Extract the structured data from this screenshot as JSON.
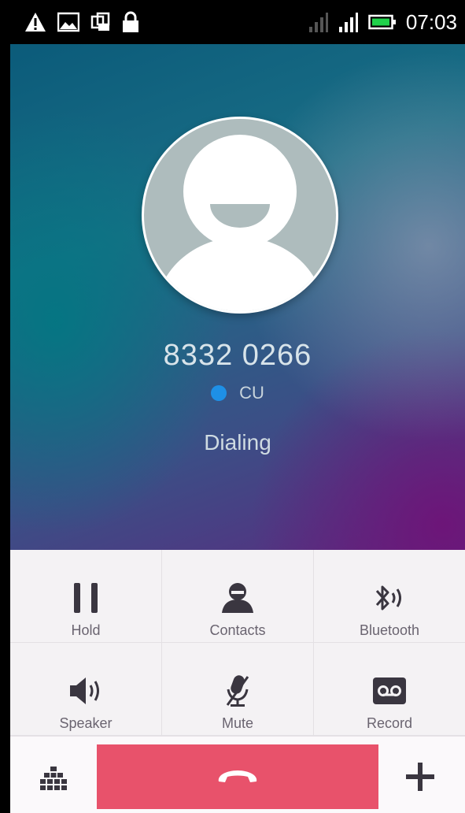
{
  "status_bar": {
    "time": "07:03",
    "left_icons": [
      "warning-icon",
      "image-icon",
      "screenshot-icon",
      "lock-icon"
    ],
    "right_icons": [
      "signal-weak-icon",
      "signal-icon",
      "battery-icon"
    ]
  },
  "call": {
    "number": "8332 0266",
    "sim_label": "CU",
    "sim_color": "#1e90e6",
    "state": "Dialing"
  },
  "controls": {
    "hold": "Hold",
    "contacts": "Contacts",
    "bluetooth": "Bluetooth",
    "speaker": "Speaker",
    "mute": "Mute",
    "record": "Record"
  },
  "bottom": {
    "dialpad_icon": "dialpad-icon",
    "end_call_icon": "end-call-icon",
    "end_call_color": "#e8526b",
    "add_call_icon": "add-call-icon"
  }
}
